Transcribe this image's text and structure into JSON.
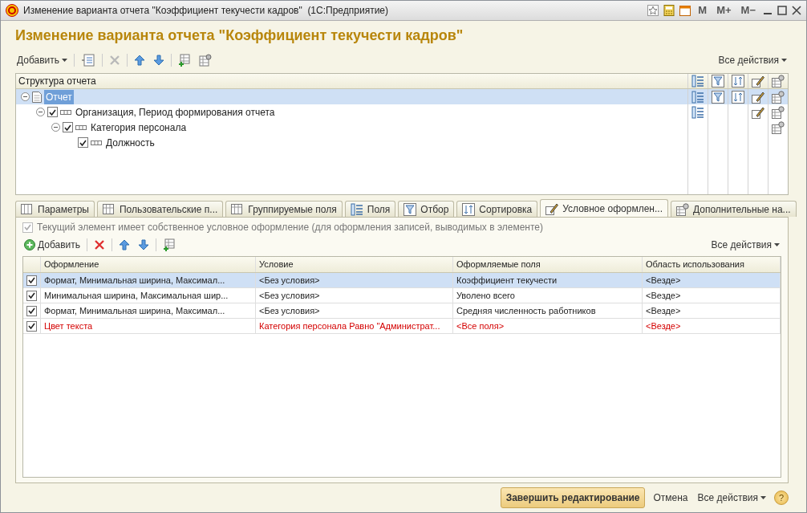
{
  "window": {
    "title": "Изменение варианта отчета \"Коэффициент текучести кадров\"  (1С:Предприятие)",
    "memory_buttons": [
      "M",
      "M+",
      "M−"
    ]
  },
  "heading": "Изменение варианта отчета \"Коэффициент текучести кадров\"",
  "toolbar": {
    "add": "Добавить",
    "all_actions": "Все действия"
  },
  "structure": {
    "header": "Структура отчета",
    "tree": [
      {
        "kind": "report",
        "label": "Отчет",
        "selected": true,
        "expanded": true,
        "settings": [
          true,
          true,
          true,
          true,
          true
        ],
        "children": [
          {
            "kind": "grouping",
            "label": "Организация, Период формирования отчета",
            "checked": true,
            "selected": false,
            "expanded": true,
            "settings": [
              true,
              false,
              false,
              true,
              true
            ],
            "children": [
              {
                "kind": "grouping",
                "label": "Категория персонала",
                "checked": true,
                "selected": false,
                "expanded": true,
                "settings": [
                  false,
                  false,
                  false,
                  false,
                  true
                ],
                "children": [
                  {
                    "kind": "grouping",
                    "label": "Должность",
                    "checked": true,
                    "selected": false,
                    "settings": [
                      false,
                      false,
                      false,
                      false,
                      false
                    ]
                  }
                ]
              }
            ]
          }
        ]
      }
    ]
  },
  "tabs": [
    {
      "label": "Параметры",
      "selected": false
    },
    {
      "label": "Пользовательские п...",
      "selected": false
    },
    {
      "label": "Группируемые поля",
      "selected": false
    },
    {
      "label": "Поля",
      "selected": false
    },
    {
      "label": "Отбор",
      "selected": false
    },
    {
      "label": "Сортировка",
      "selected": false
    },
    {
      "label": "Условное оформлен...",
      "selected": true
    },
    {
      "label": "Дополнительные на...",
      "selected": false
    }
  ],
  "own_formatting": {
    "label": "Текущий элемент имеет собственное условное оформление (для оформления записей, выводимых в элементе)",
    "checked": true,
    "disabled": true
  },
  "sub_toolbar": {
    "add": "Добавить",
    "all_actions": "Все действия"
  },
  "table": {
    "columns": [
      "Оформление",
      "Условие",
      "Оформляемые поля",
      "Область использования"
    ],
    "rows": [
      {
        "checked": true,
        "selected": true,
        "highlighted": false,
        "cells": [
          "Формат, Минимальная ширина, Максимал...",
          "<Без условия>",
          "Коэффициент текучести",
          "<Везде>"
        ]
      },
      {
        "checked": true,
        "selected": false,
        "highlighted": false,
        "cells": [
          "Минимальная ширина, Максимальная шир...",
          "<Без условия>",
          "Уволено всего",
          "<Везде>"
        ]
      },
      {
        "checked": true,
        "selected": false,
        "highlighted": false,
        "cells": [
          "Формат, Минимальная ширина, Максимал...",
          "<Без условия>",
          "Средняя численность работников",
          "<Везде>"
        ]
      },
      {
        "checked": true,
        "selected": false,
        "highlighted": true,
        "cells": [
          "Цвет текста",
          "Категория персонала Равно \"Администрат...",
          "<Все поля>",
          "<Везде>"
        ]
      }
    ]
  },
  "footer": {
    "finish": "Завершить редактирование",
    "cancel": "Отмена",
    "all_actions": "Все действия",
    "help": "?"
  }
}
